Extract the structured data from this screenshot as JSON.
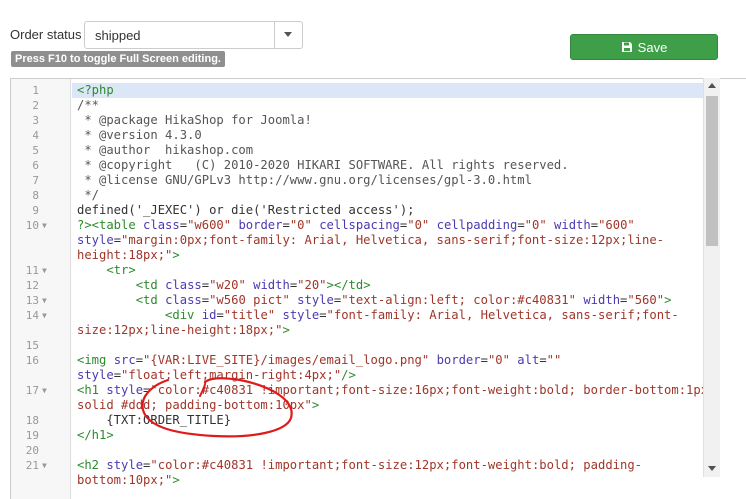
{
  "order_status": {
    "label": "Order status",
    "selected": "shipped"
  },
  "hint": "Press F10 to toggle Full Screen editing.",
  "save": {
    "label": "Save",
    "icon": "floppy-disk-icon",
    "color": "#3f9f48"
  },
  "editor": {
    "lines": [
      {
        "n": "1",
        "fold": false,
        "wrapped": 1
      },
      {
        "n": "2",
        "fold": false,
        "wrapped": 1
      },
      {
        "n": "3",
        "fold": false,
        "wrapped": 1
      },
      {
        "n": "4",
        "fold": false,
        "wrapped": 1
      },
      {
        "n": "5",
        "fold": false,
        "wrapped": 1
      },
      {
        "n": "6",
        "fold": false,
        "wrapped": 1
      },
      {
        "n": "7",
        "fold": false,
        "wrapped": 1
      },
      {
        "n": "8",
        "fold": false,
        "wrapped": 1
      },
      {
        "n": "9",
        "fold": false,
        "wrapped": 1
      },
      {
        "n": "10",
        "fold": true,
        "wrapped": 3
      },
      {
        "n": "11",
        "fold": true,
        "wrapped": 1
      },
      {
        "n": "12",
        "fold": false,
        "wrapped": 1
      },
      {
        "n": "13",
        "fold": true,
        "wrapped": 1
      },
      {
        "n": "14",
        "fold": true,
        "wrapped": 2
      },
      {
        "n": "15",
        "fold": false,
        "wrapped": 1
      },
      {
        "n": "16",
        "fold": false,
        "wrapped": 2
      },
      {
        "n": "17",
        "fold": true,
        "wrapped": 2
      },
      {
        "n": "18",
        "fold": false,
        "wrapped": 1
      },
      {
        "n": "19",
        "fold": false,
        "wrapped": 1
      },
      {
        "n": "20",
        "fold": false,
        "wrapped": 1
      },
      {
        "n": "21",
        "fold": true,
        "wrapped": 2
      }
    ],
    "code": [
      [
        {
          "c": "t-tag",
          "t": "<?php"
        }
      ],
      [
        {
          "c": "t-cm",
          "t": "/**"
        }
      ],
      [
        {
          "c": "t-cm",
          "t": " * @package HikaShop for Joomla!"
        }
      ],
      [
        {
          "c": "t-cm",
          "t": " * @version 4.3.0"
        }
      ],
      [
        {
          "c": "t-cm",
          "t": " * @author  hikashop.com"
        }
      ],
      [
        {
          "c": "t-cm",
          "t": " * @copyright   (C) 2010-2020 HIKARI SOFTWARE. All rights reserved."
        }
      ],
      [
        {
          "c": "t-cm",
          "t": " * @license GNU/GPLv3 http://www.gnu.org/licenses/gpl-3.0.html"
        }
      ],
      [
        {
          "c": "t-cm",
          "t": " */"
        }
      ],
      [
        {
          "c": "t-kw",
          "t": "defined('_JEXEC') or die('Restricted access');"
        }
      ],
      [
        {
          "c": "t-tag",
          "t": "?><table "
        },
        {
          "c": "t-attr",
          "t": "class"
        },
        {
          "c": "t-kw",
          "t": "="
        },
        {
          "c": "t-str",
          "t": "\"w600\""
        },
        {
          "c": "t-kw",
          "t": " "
        },
        {
          "c": "t-attr",
          "t": "border"
        },
        {
          "c": "t-kw",
          "t": "="
        },
        {
          "c": "t-str",
          "t": "\"0\""
        },
        {
          "c": "t-kw",
          "t": " "
        },
        {
          "c": "t-attr",
          "t": "cellspacing"
        },
        {
          "c": "t-kw",
          "t": "="
        },
        {
          "c": "t-str",
          "t": "\"0\""
        },
        {
          "c": "t-kw",
          "t": " "
        },
        {
          "c": "t-attr",
          "t": "cellpadding"
        },
        {
          "c": "t-kw",
          "t": "="
        },
        {
          "c": "t-str",
          "t": "\"0\""
        },
        {
          "c": "t-kw",
          "t": " "
        },
        {
          "c": "t-attr",
          "t": "width"
        },
        {
          "c": "t-kw",
          "t": "="
        },
        {
          "c": "t-str",
          "t": "\"600\""
        }
      ],
      [
        {
          "c": "t-attr",
          "t": "style"
        },
        {
          "c": "t-kw",
          "t": "="
        },
        {
          "c": "t-str",
          "t": "\"margin:0px;font-family: Arial, Helvetica, sans-serif;font-size:12px;line-"
        }
      ],
      [
        {
          "c": "t-str",
          "t": "height:18px;\""
        },
        {
          "c": "t-tag",
          "t": ">"
        }
      ],
      [
        {
          "c": "t-tag",
          "t": "    <tr>"
        }
      ],
      [
        {
          "c": "t-tag",
          "t": "        <td "
        },
        {
          "c": "t-attr",
          "t": "class"
        },
        {
          "c": "t-kw",
          "t": "="
        },
        {
          "c": "t-str",
          "t": "\"w20\""
        },
        {
          "c": "t-kw",
          "t": " "
        },
        {
          "c": "t-attr",
          "t": "width"
        },
        {
          "c": "t-kw",
          "t": "="
        },
        {
          "c": "t-str",
          "t": "\"20\""
        },
        {
          "c": "t-tag",
          "t": "></td>"
        }
      ],
      [
        {
          "c": "t-tag",
          "t": "        <td "
        },
        {
          "c": "t-attr",
          "t": "class"
        },
        {
          "c": "t-kw",
          "t": "="
        },
        {
          "c": "t-str",
          "t": "\"w560 pict\""
        },
        {
          "c": "t-kw",
          "t": " "
        },
        {
          "c": "t-attr",
          "t": "style"
        },
        {
          "c": "t-kw",
          "t": "="
        },
        {
          "c": "t-str",
          "t": "\"text-align:left; color:#c40831\""
        },
        {
          "c": "t-kw",
          "t": " "
        },
        {
          "c": "t-attr",
          "t": "width"
        },
        {
          "c": "t-kw",
          "t": "="
        },
        {
          "c": "t-str",
          "t": "\"560\""
        },
        {
          "c": "t-tag",
          "t": ">"
        }
      ],
      [
        {
          "c": "t-tag",
          "t": "            <div "
        },
        {
          "c": "t-attr",
          "t": "id"
        },
        {
          "c": "t-kw",
          "t": "="
        },
        {
          "c": "t-str",
          "t": "\"title\""
        },
        {
          "c": "t-kw",
          "t": " "
        },
        {
          "c": "t-attr",
          "t": "style"
        },
        {
          "c": "t-kw",
          "t": "="
        },
        {
          "c": "t-str",
          "t": "\"font-family: Arial, Helvetica, sans-serif;font-"
        }
      ],
      [
        {
          "c": "t-str",
          "t": "size:12px;line-height:18px;\""
        },
        {
          "c": "t-tag",
          "t": ">"
        }
      ],
      [
        {
          "c": "t-kw",
          "t": ""
        }
      ],
      [
        {
          "c": "t-tag",
          "t": "<img "
        },
        {
          "c": "t-attr",
          "t": "src"
        },
        {
          "c": "t-kw",
          "t": "="
        },
        {
          "c": "t-str",
          "t": "\"{VAR:LIVE_SITE}/images/email_logo.png\""
        },
        {
          "c": "t-kw",
          "t": " "
        },
        {
          "c": "t-attr",
          "t": "border"
        },
        {
          "c": "t-kw",
          "t": "="
        },
        {
          "c": "t-str",
          "t": "\"0\""
        },
        {
          "c": "t-kw",
          "t": " "
        },
        {
          "c": "t-attr",
          "t": "alt"
        },
        {
          "c": "t-kw",
          "t": "="
        },
        {
          "c": "t-str",
          "t": "\"\""
        }
      ],
      [
        {
          "c": "t-attr",
          "t": "style"
        },
        {
          "c": "t-kw",
          "t": "="
        },
        {
          "c": "t-str",
          "t": "\"float:left;margin-right:4px;\""
        },
        {
          "c": "t-tag",
          "t": "/>"
        }
      ],
      [
        {
          "c": "t-tag",
          "t": "<h1 "
        },
        {
          "c": "t-attr",
          "t": "style"
        },
        {
          "c": "t-kw",
          "t": "="
        },
        {
          "c": "t-str",
          "t": "\"color:#c40831 !important;font-size:16px;font-weight:bold; border-bottom:1px"
        }
      ],
      [
        {
          "c": "t-str",
          "t": "solid #ddd; padding-bottom:10px\""
        },
        {
          "c": "t-tag",
          "t": ">"
        }
      ],
      [
        {
          "c": "t-kw",
          "t": "    {TXT:ORDER_TITLE}"
        }
      ],
      [
        {
          "c": "t-tag",
          "t": "</h1>"
        }
      ],
      [
        {
          "c": "t-kw",
          "t": ""
        }
      ],
      [
        {
          "c": "t-tag",
          "t": "<h2 "
        },
        {
          "c": "t-attr",
          "t": "style"
        },
        {
          "c": "t-kw",
          "t": "="
        },
        {
          "c": "t-str",
          "t": "\"color:#c40831 !important;font-size:12px;font-weight:bold; padding-"
        }
      ],
      [
        {
          "c": "t-str",
          "t": "bottom:10px;\""
        },
        {
          "c": "t-tag",
          "t": ">"
        }
      ]
    ]
  }
}
